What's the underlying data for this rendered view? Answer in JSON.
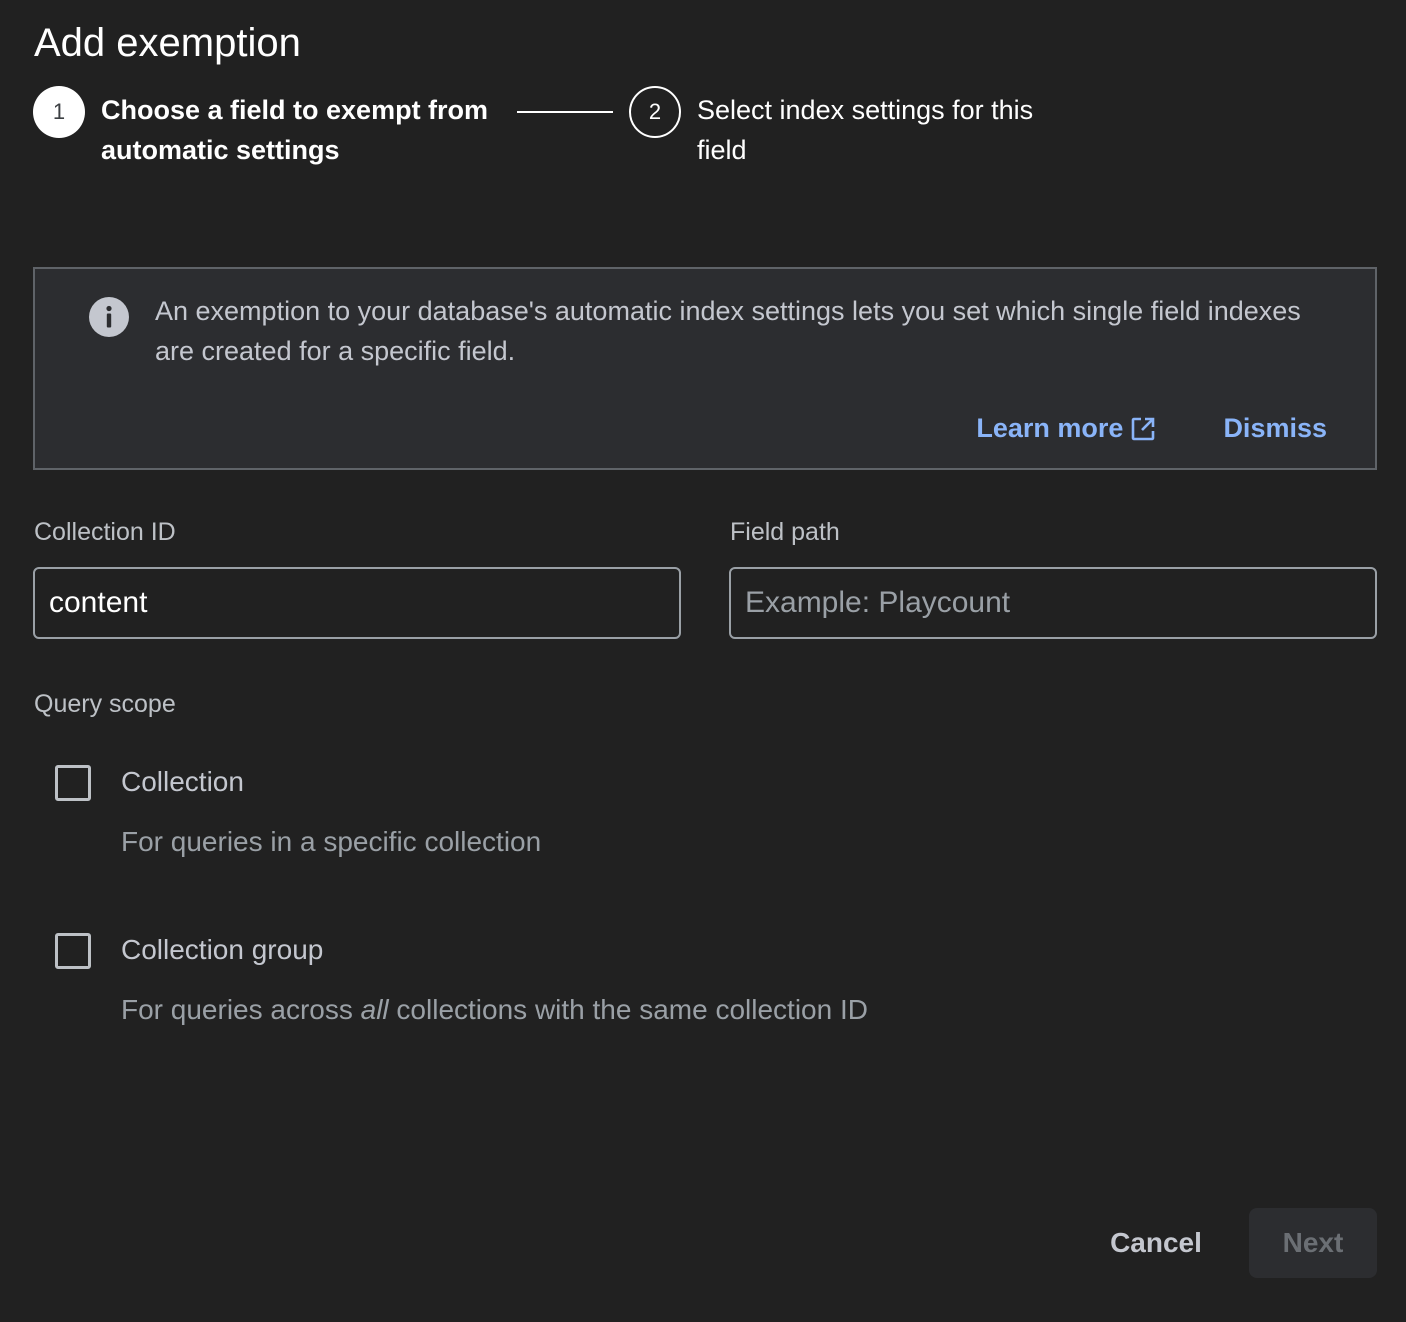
{
  "dialog": {
    "title": "Add exemption"
  },
  "stepper": {
    "steps": [
      {
        "number": "1",
        "label": "Choose a field to exempt from automatic settings",
        "state": "active"
      },
      {
        "number": "2",
        "label": "Select index settings for this field",
        "state": "inactive"
      }
    ]
  },
  "banner": {
    "icon": "info-icon",
    "text": "An exemption to your database's automatic index settings lets you set which single field indexes are created for a specific field.",
    "learn_more_label": "Learn more",
    "learn_more_icon": "external-link-icon",
    "dismiss_label": "Dismiss"
  },
  "fields": {
    "collection_id": {
      "label": "Collection ID",
      "value": "content"
    },
    "field_path": {
      "label": "Field path",
      "value": "",
      "placeholder": "Example: Playcount"
    }
  },
  "query_scope": {
    "label": "Query scope",
    "options": [
      {
        "title": "Collection",
        "description": "For queries in a specific collection",
        "checked": false
      },
      {
        "title": "Collection group",
        "description_before": "For queries across ",
        "description_emphasis": "all",
        "description_after": " collections with the same collection ID",
        "checked": false
      }
    ]
  },
  "footer": {
    "cancel_label": "Cancel",
    "next_label": "Next",
    "next_enabled": false
  },
  "colors": {
    "background": "#212121",
    "link": "#8ab4f8",
    "banner_bg": "#2c2d30"
  }
}
